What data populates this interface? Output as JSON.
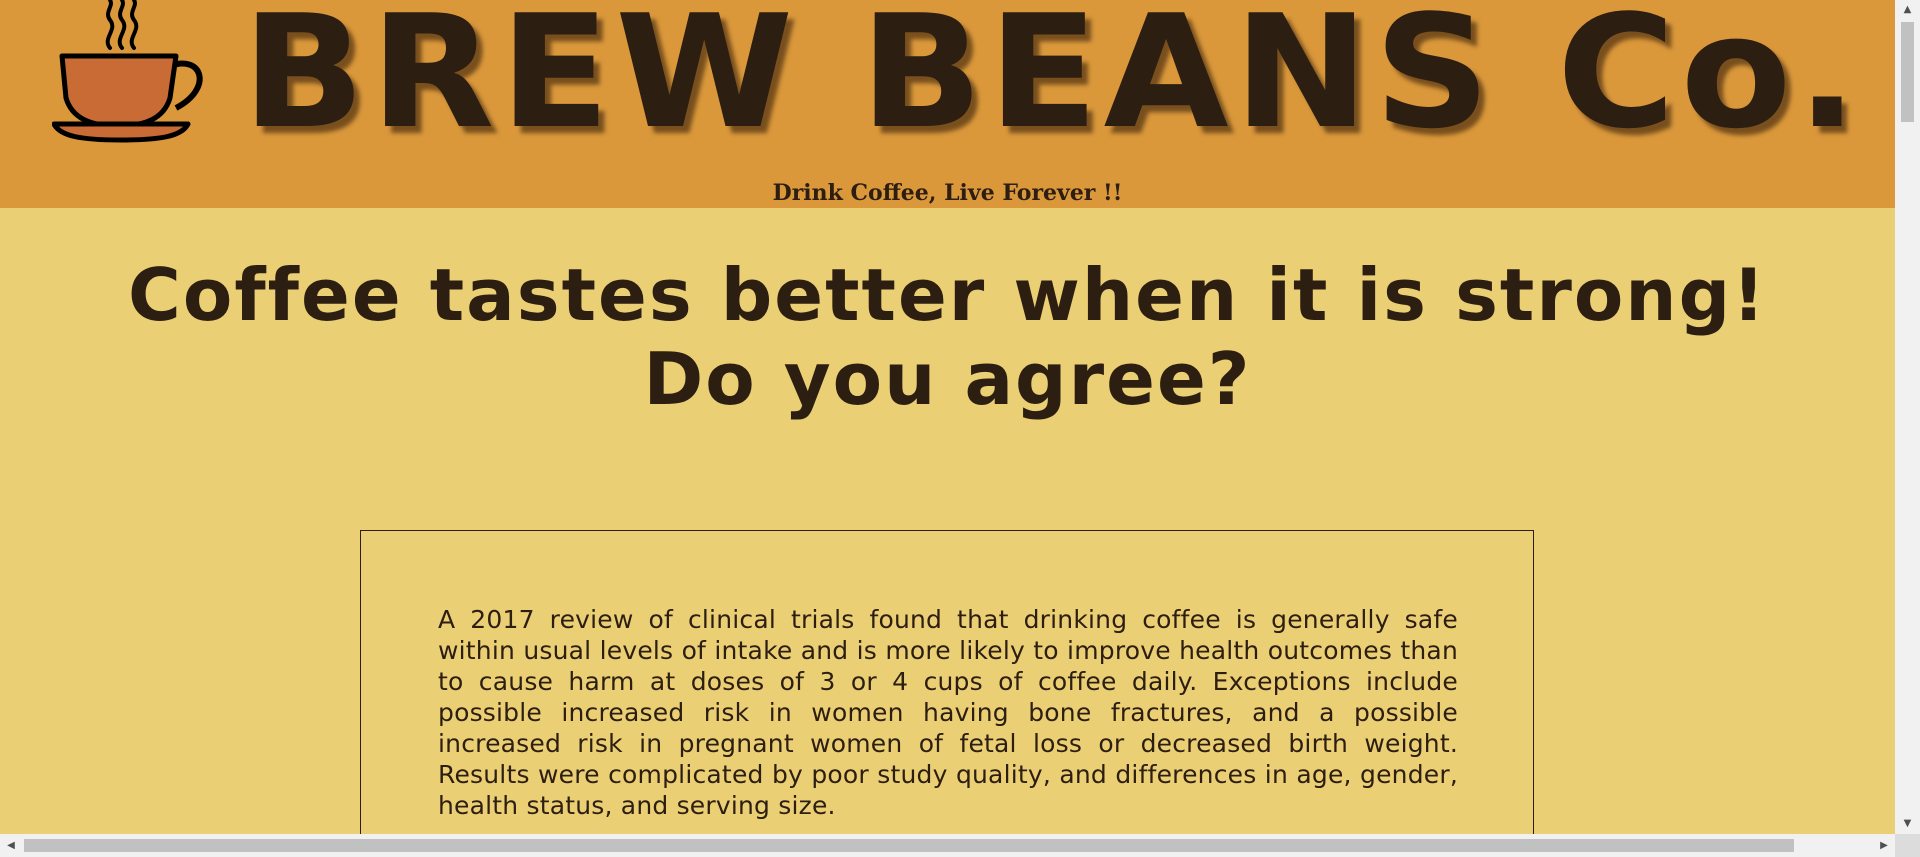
{
  "header": {
    "brand": "BREW BEANS Co.",
    "tagline": "Drink Coffee, Live Forever !!",
    "logo_icon": "coffee-cup-icon"
  },
  "main": {
    "headline_part1": "Coffee tastes better when it is ",
    "headline_strong1": "strong!",
    "headline_strong2": "Do you agree?",
    "article_text": "A 2017 review of clinical trials found that drinking coffee is generally safe within usual levels of intake and is more likely to improve health outcomes than to cause harm at doses of 3 or 4 cups of coffee daily. Exceptions include possible increased risk in women having bone fractures, and a possible increased risk in pregnant women of fetal loss or decreased birth weight. Results were complicated by poor study quality, and differences in age, gender, health status, and serving size."
  },
  "scrollbars": {
    "up_arrow": "▲",
    "down_arrow": "▼",
    "left_arrow": "◀",
    "right_arrow": "▶"
  },
  "colors": {
    "header_bg": "#da983b",
    "page_bg": "#ebcf74",
    "text": "#2d1e12",
    "cup": "#c96b34"
  }
}
